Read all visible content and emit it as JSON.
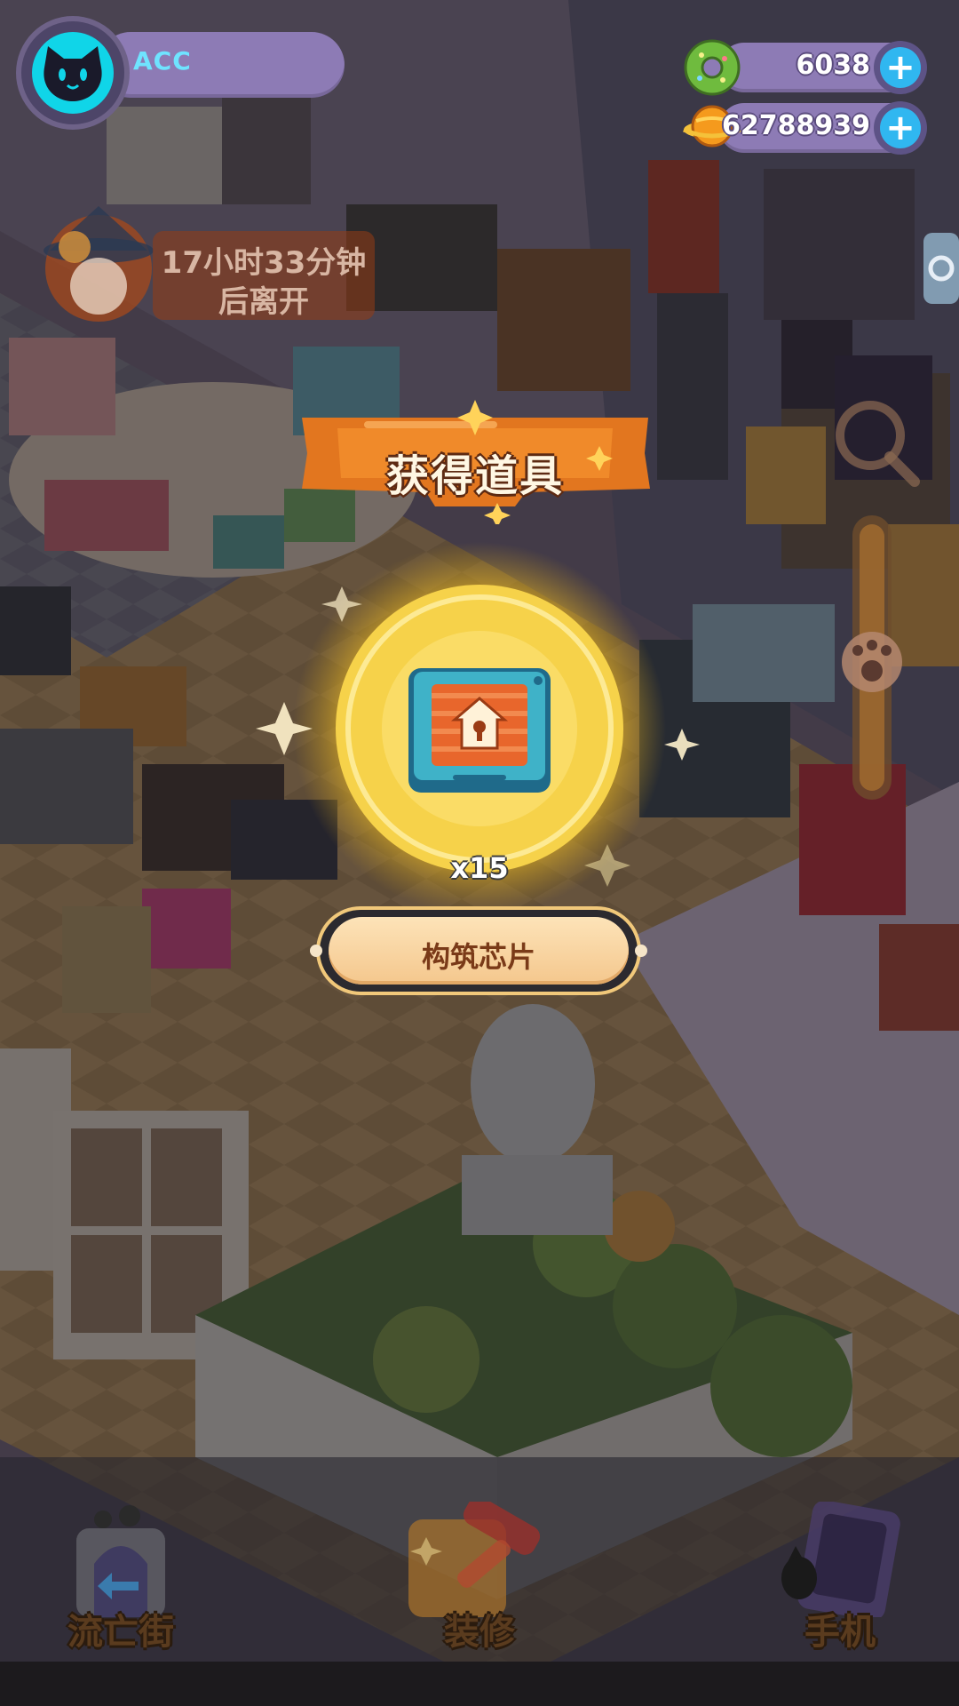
{
  "player": {
    "name": "ACC",
    "avatar_icon": "cat-face-icon"
  },
  "currencies": [
    {
      "name": "donut-currency",
      "icon": "donut-icon",
      "value": "6038"
    },
    {
      "name": "planet-currency",
      "icon": "planet-coin-icon",
      "value": "62788939"
    }
  ],
  "visitor": {
    "timer_line1": "17小时33分钟",
    "timer_line2": "后离开"
  },
  "reward": {
    "title": "获得道具",
    "quantity": "x15",
    "item_name": "构筑芯片",
    "item_icon": "build-chip-icon"
  },
  "nav": [
    {
      "label": "流亡街",
      "icon": "portal-icon"
    },
    {
      "label": "装修",
      "icon": "paint-roller-icon"
    },
    {
      "label": "手机",
      "icon": "phone-icon"
    }
  ],
  "colors": {
    "hud_pill": "#8d7bb5",
    "plus_button": "#30b7f0",
    "banner_orange": "#e2761f",
    "glow_yellow": "#f7d64a",
    "name_plate": "#f4c78d"
  }
}
